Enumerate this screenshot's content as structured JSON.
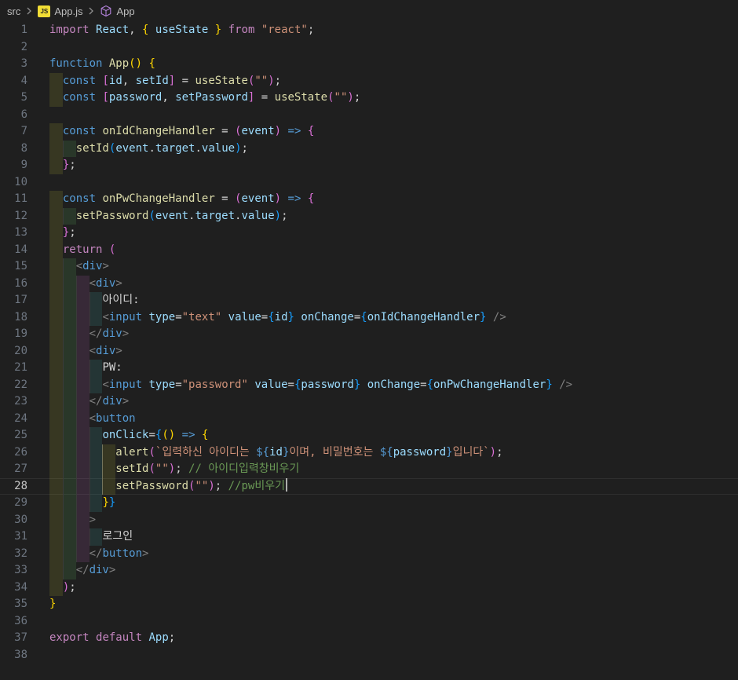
{
  "app": {
    "kind": "vscode-editor"
  },
  "breadcrumb": {
    "items": [
      {
        "label": "src"
      },
      {
        "label": "App.js",
        "icon": "javascript-file-icon"
      },
      {
        "label": "App",
        "icon": "symbol-class-icon"
      }
    ],
    "js_icon_text": "JS",
    "colors": {
      "text": "#BDBDBD",
      "chevron": "#8F8F8F",
      "js_badge": "#F1DD35",
      "symbol": "#B180D7"
    }
  },
  "editor": {
    "language": "javascript-react",
    "active_line": 28,
    "cursor": {
      "line": 28,
      "at_line_end": true
    },
    "active_guide": {
      "lines": [
        26,
        27,
        28
      ],
      "level": 4
    },
    "colors": {
      "background": "#1F1F1F",
      "line_number": "#6E7681",
      "line_number_active": "#C6C6C6",
      "line_highlight_border": "#2E2E2E",
      "cursor": "#AEAFAD",
      "indent_guide": "#3B3B3B",
      "indent_guide_active": "#73735C",
      "indent_levels": [
        "rgba(255,255,64,0.11)",
        "rgba(127,255,127,0.11)",
        "rgba(255,127,255,0.11)",
        "rgba(79,236,236,0.11)"
      ],
      "token": {
        "kw": "#C586C0",
        "st": "#569CD6",
        "fn": "#DCDCAA",
        "var": "#9CDCFE",
        "str": "#CE9178",
        "cm": "#6A9955",
        "fg": "#D4D4D4",
        "ang": "#808080",
        "b1": "#FFD700",
        "b2": "#DA70D6",
        "b3": "#179FFF"
      }
    },
    "lines": [
      {
        "n": 1,
        "tokens": [
          [
            "import",
            "kw"
          ],
          [
            " ",
            "fg"
          ],
          [
            "React",
            "var"
          ],
          [
            ", ",
            "fg"
          ],
          [
            "{",
            "b1"
          ],
          [
            " ",
            "fg"
          ],
          [
            "useState",
            "var"
          ],
          [
            " ",
            "fg"
          ],
          [
            "}",
            "b1"
          ],
          [
            " ",
            "fg"
          ],
          [
            "from",
            "kw"
          ],
          [
            " ",
            "fg"
          ],
          [
            "\"react\"",
            "str"
          ],
          [
            ";",
            "fg"
          ]
        ]
      },
      {
        "n": 2,
        "tokens": []
      },
      {
        "n": 3,
        "tokens": [
          [
            "function",
            "st"
          ],
          [
            " ",
            "fg"
          ],
          [
            "App",
            "fn"
          ],
          [
            "(",
            "b1"
          ],
          [
            ")",
            "b1"
          ],
          [
            " ",
            "fg"
          ],
          [
            "{",
            "b1"
          ]
        ]
      },
      {
        "n": 4,
        "tokens": [
          [
            "  ",
            "fg"
          ],
          [
            "const",
            "st"
          ],
          [
            " ",
            "fg"
          ],
          [
            "[",
            "b2"
          ],
          [
            "id",
            "var"
          ],
          [
            ", ",
            "fg"
          ],
          [
            "setId",
            "var"
          ],
          [
            "]",
            "b2"
          ],
          [
            " = ",
            "fg"
          ],
          [
            "useState",
            "fn"
          ],
          [
            "(",
            "b2"
          ],
          [
            "\"\"",
            "str"
          ],
          [
            ")",
            "b2"
          ],
          [
            ";",
            "fg"
          ]
        ]
      },
      {
        "n": 5,
        "tokens": [
          [
            "  ",
            "fg"
          ],
          [
            "const",
            "st"
          ],
          [
            " ",
            "fg"
          ],
          [
            "[",
            "b2"
          ],
          [
            "password",
            "var"
          ],
          [
            ", ",
            "fg"
          ],
          [
            "setPassword",
            "var"
          ],
          [
            "]",
            "b2"
          ],
          [
            " = ",
            "fg"
          ],
          [
            "useState",
            "fn"
          ],
          [
            "(",
            "b2"
          ],
          [
            "\"\"",
            "str"
          ],
          [
            ")",
            "b2"
          ],
          [
            ";",
            "fg"
          ]
        ]
      },
      {
        "n": 6,
        "tokens": []
      },
      {
        "n": 7,
        "tokens": [
          [
            "  ",
            "fg"
          ],
          [
            "const",
            "st"
          ],
          [
            " ",
            "fg"
          ],
          [
            "onIdChangeHandler",
            "fn"
          ],
          [
            " = ",
            "fg"
          ],
          [
            "(",
            "b2"
          ],
          [
            "event",
            "var"
          ],
          [
            ")",
            "b2"
          ],
          [
            " ",
            "fg"
          ],
          [
            "=>",
            "st"
          ],
          [
            " ",
            "fg"
          ],
          [
            "{",
            "b2"
          ]
        ]
      },
      {
        "n": 8,
        "tokens": [
          [
            "    ",
            "fg"
          ],
          [
            "setId",
            "fn"
          ],
          [
            "(",
            "b3"
          ],
          [
            "event",
            "var"
          ],
          [
            ".",
            "fg"
          ],
          [
            "target",
            "var"
          ],
          [
            ".",
            "fg"
          ],
          [
            "value",
            "var"
          ],
          [
            ")",
            "b3"
          ],
          [
            ";",
            "fg"
          ]
        ]
      },
      {
        "n": 9,
        "tokens": [
          [
            "  ",
            "fg"
          ],
          [
            "}",
            "b2"
          ],
          [
            ";",
            "fg"
          ]
        ]
      },
      {
        "n": 10,
        "tokens": []
      },
      {
        "n": 11,
        "tokens": [
          [
            "  ",
            "fg"
          ],
          [
            "const",
            "st"
          ],
          [
            " ",
            "fg"
          ],
          [
            "onPwChangeHandler",
            "fn"
          ],
          [
            " = ",
            "fg"
          ],
          [
            "(",
            "b2"
          ],
          [
            "event",
            "var"
          ],
          [
            ")",
            "b2"
          ],
          [
            " ",
            "fg"
          ],
          [
            "=>",
            "st"
          ],
          [
            " ",
            "fg"
          ],
          [
            "{",
            "b2"
          ]
        ]
      },
      {
        "n": 12,
        "tokens": [
          [
            "    ",
            "fg"
          ],
          [
            "setPassword",
            "fn"
          ],
          [
            "(",
            "b3"
          ],
          [
            "event",
            "var"
          ],
          [
            ".",
            "fg"
          ],
          [
            "target",
            "var"
          ],
          [
            ".",
            "fg"
          ],
          [
            "value",
            "var"
          ],
          [
            ")",
            "b3"
          ],
          [
            ";",
            "fg"
          ]
        ]
      },
      {
        "n": 13,
        "tokens": [
          [
            "  ",
            "fg"
          ],
          [
            "}",
            "b2"
          ],
          [
            ";",
            "fg"
          ]
        ]
      },
      {
        "n": 14,
        "tokens": [
          [
            "  ",
            "fg"
          ],
          [
            "return",
            "kw"
          ],
          [
            " ",
            "fg"
          ],
          [
            "(",
            "b2"
          ]
        ]
      },
      {
        "n": 15,
        "tokens": [
          [
            "    ",
            "fg"
          ],
          [
            "<",
            "ang"
          ],
          [
            "div",
            "st"
          ],
          [
            ">",
            "ang"
          ]
        ]
      },
      {
        "n": 16,
        "tokens": [
          [
            "      ",
            "fg"
          ],
          [
            "<",
            "ang"
          ],
          [
            "div",
            "st"
          ],
          [
            ">",
            "ang"
          ]
        ]
      },
      {
        "n": 17,
        "tokens": [
          [
            "        ",
            "fg"
          ],
          [
            "아이디:",
            "fg"
          ]
        ]
      },
      {
        "n": 18,
        "tokens": [
          [
            "        ",
            "fg"
          ],
          [
            "<",
            "ang"
          ],
          [
            "input",
            "st"
          ],
          [
            " ",
            "fg"
          ],
          [
            "type",
            "var"
          ],
          [
            "=",
            "fg"
          ],
          [
            "\"text\"",
            "str"
          ],
          [
            " ",
            "fg"
          ],
          [
            "value",
            "var"
          ],
          [
            "=",
            "fg"
          ],
          [
            "{",
            "b3"
          ],
          [
            "id",
            "var"
          ],
          [
            "}",
            "b3"
          ],
          [
            " ",
            "fg"
          ],
          [
            "onChange",
            "var"
          ],
          [
            "=",
            "fg"
          ],
          [
            "{",
            "b3"
          ],
          [
            "onIdChangeHandler",
            "var"
          ],
          [
            "}",
            "b3"
          ],
          [
            " ",
            "fg"
          ],
          [
            "/>",
            "ang"
          ]
        ]
      },
      {
        "n": 19,
        "tokens": [
          [
            "      ",
            "fg"
          ],
          [
            "</",
            "ang"
          ],
          [
            "div",
            "st"
          ],
          [
            ">",
            "ang"
          ]
        ]
      },
      {
        "n": 20,
        "tokens": [
          [
            "      ",
            "fg"
          ],
          [
            "<",
            "ang"
          ],
          [
            "div",
            "st"
          ],
          [
            ">",
            "ang"
          ]
        ]
      },
      {
        "n": 21,
        "tokens": [
          [
            "        ",
            "fg"
          ],
          [
            "PW:",
            "fg"
          ]
        ]
      },
      {
        "n": 22,
        "tokens": [
          [
            "        ",
            "fg"
          ],
          [
            "<",
            "ang"
          ],
          [
            "input",
            "st"
          ],
          [
            " ",
            "fg"
          ],
          [
            "type",
            "var"
          ],
          [
            "=",
            "fg"
          ],
          [
            "\"password\"",
            "str"
          ],
          [
            " ",
            "fg"
          ],
          [
            "value",
            "var"
          ],
          [
            "=",
            "fg"
          ],
          [
            "{",
            "b3"
          ],
          [
            "password",
            "var"
          ],
          [
            "}",
            "b3"
          ],
          [
            " ",
            "fg"
          ],
          [
            "onChange",
            "var"
          ],
          [
            "=",
            "fg"
          ],
          [
            "{",
            "b3"
          ],
          [
            "onPwChangeHandler",
            "var"
          ],
          [
            "}",
            "b3"
          ],
          [
            " ",
            "fg"
          ],
          [
            "/>",
            "ang"
          ]
        ]
      },
      {
        "n": 23,
        "tokens": [
          [
            "      ",
            "fg"
          ],
          [
            "</",
            "ang"
          ],
          [
            "div",
            "st"
          ],
          [
            ">",
            "ang"
          ]
        ]
      },
      {
        "n": 24,
        "tokens": [
          [
            "      ",
            "fg"
          ],
          [
            "<",
            "ang"
          ],
          [
            "button",
            "st"
          ]
        ]
      },
      {
        "n": 25,
        "tokens": [
          [
            "        ",
            "fg"
          ],
          [
            "onClick",
            "var"
          ],
          [
            "=",
            "fg"
          ],
          [
            "{",
            "b3"
          ],
          [
            "(",
            "b1"
          ],
          [
            ")",
            "b1"
          ],
          [
            " ",
            "fg"
          ],
          [
            "=>",
            "st"
          ],
          [
            " ",
            "fg"
          ],
          [
            "{",
            "b1"
          ]
        ]
      },
      {
        "n": 26,
        "tokens": [
          [
            "          ",
            "fg"
          ],
          [
            "alert",
            "fn"
          ],
          [
            "(",
            "b2"
          ],
          [
            "`입력하신 아이디는 ",
            "str"
          ],
          [
            "${",
            "st"
          ],
          [
            "id",
            "var"
          ],
          [
            "}",
            "st"
          ],
          [
            "이며, 비밀번호는 ",
            "str"
          ],
          [
            "${",
            "st"
          ],
          [
            "password",
            "var"
          ],
          [
            "}",
            "st"
          ],
          [
            "입니다`",
            "str"
          ],
          [
            ")",
            "b2"
          ],
          [
            ";",
            "fg"
          ]
        ]
      },
      {
        "n": 27,
        "tokens": [
          [
            "          ",
            "fg"
          ],
          [
            "setId",
            "fn"
          ],
          [
            "(",
            "b2"
          ],
          [
            "\"\"",
            "str"
          ],
          [
            ")",
            "b2"
          ],
          [
            "; ",
            "fg"
          ],
          [
            "// 아이디입력창비우기",
            "cm"
          ]
        ]
      },
      {
        "n": 28,
        "tokens": [
          [
            "          ",
            "fg"
          ],
          [
            "setPassword",
            "fn"
          ],
          [
            "(",
            "b2"
          ],
          [
            "\"\"",
            "str"
          ],
          [
            ")",
            "b2"
          ],
          [
            "; ",
            "fg"
          ],
          [
            "//pw비우기",
            "cm"
          ]
        ]
      },
      {
        "n": 29,
        "tokens": [
          [
            "        ",
            "fg"
          ],
          [
            "}",
            "b1"
          ],
          [
            "}",
            "b3"
          ]
        ]
      },
      {
        "n": 30,
        "tokens": [
          [
            "      ",
            "fg"
          ],
          [
            ">",
            "ang"
          ]
        ]
      },
      {
        "n": 31,
        "tokens": [
          [
            "        ",
            "fg"
          ],
          [
            "로그인",
            "fg"
          ]
        ]
      },
      {
        "n": 32,
        "tokens": [
          [
            "      ",
            "fg"
          ],
          [
            "</",
            "ang"
          ],
          [
            "button",
            "st"
          ],
          [
            ">",
            "ang"
          ]
        ]
      },
      {
        "n": 33,
        "tokens": [
          [
            "    ",
            "fg"
          ],
          [
            "</",
            "ang"
          ],
          [
            "div",
            "st"
          ],
          [
            ">",
            "ang"
          ]
        ]
      },
      {
        "n": 34,
        "tokens": [
          [
            "  ",
            "fg"
          ],
          [
            ")",
            "b2"
          ],
          [
            ";",
            "fg"
          ]
        ]
      },
      {
        "n": 35,
        "tokens": [
          [
            "}",
            "b1"
          ]
        ]
      },
      {
        "n": 36,
        "tokens": []
      },
      {
        "n": 37,
        "tokens": [
          [
            "export",
            "kw"
          ],
          [
            " ",
            "fg"
          ],
          [
            "default",
            "kw"
          ],
          [
            " ",
            "fg"
          ],
          [
            "App",
            "var"
          ],
          [
            ";",
            "fg"
          ]
        ]
      },
      {
        "n": 38,
        "tokens": []
      }
    ]
  }
}
